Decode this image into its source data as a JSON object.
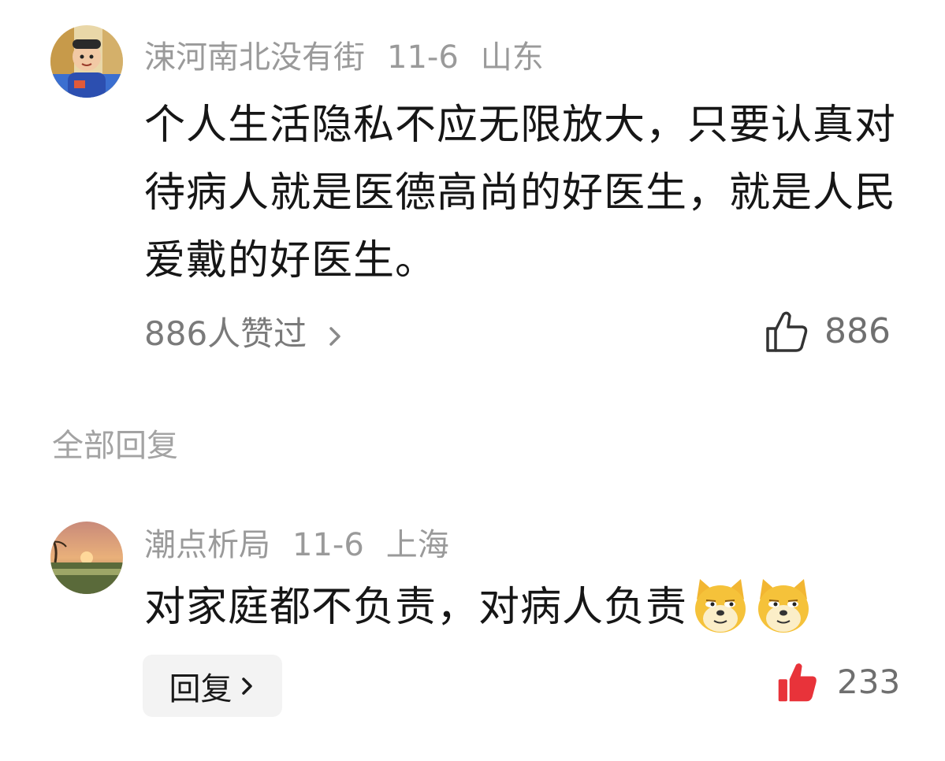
{
  "comment": {
    "username": "涑河南北没有街",
    "date": "11-6",
    "location": "山东",
    "text": "个人生活隐私不应无限放大，只要认真对待病人就是医德高尚的好医生，就是人民爱戴的好医生。",
    "likes_summary": "886人赞过",
    "like_count": "886",
    "avatar_icon": "child-photo-avatar",
    "like_icon": "thumbs-up-outline-icon"
  },
  "replies_section": {
    "title": "全部回复"
  },
  "reply": {
    "username": "潮点析局",
    "date": "11-6",
    "location": "上海",
    "text": "对家庭都不负责，对病人负责",
    "emojis": [
      "doge-emoji",
      "doge-emoji"
    ],
    "reply_button_label": "回复",
    "like_count": "233",
    "avatar_icon": "sunset-landscape-avatar",
    "like_icon": "thumbs-up-filled-icon",
    "like_color": "#e8333a"
  },
  "colors": {
    "meta_text": "#9a9a9a",
    "body_text": "#161616",
    "liked_red": "#e8333a",
    "reply_button_bg": "#f3f3f3"
  }
}
